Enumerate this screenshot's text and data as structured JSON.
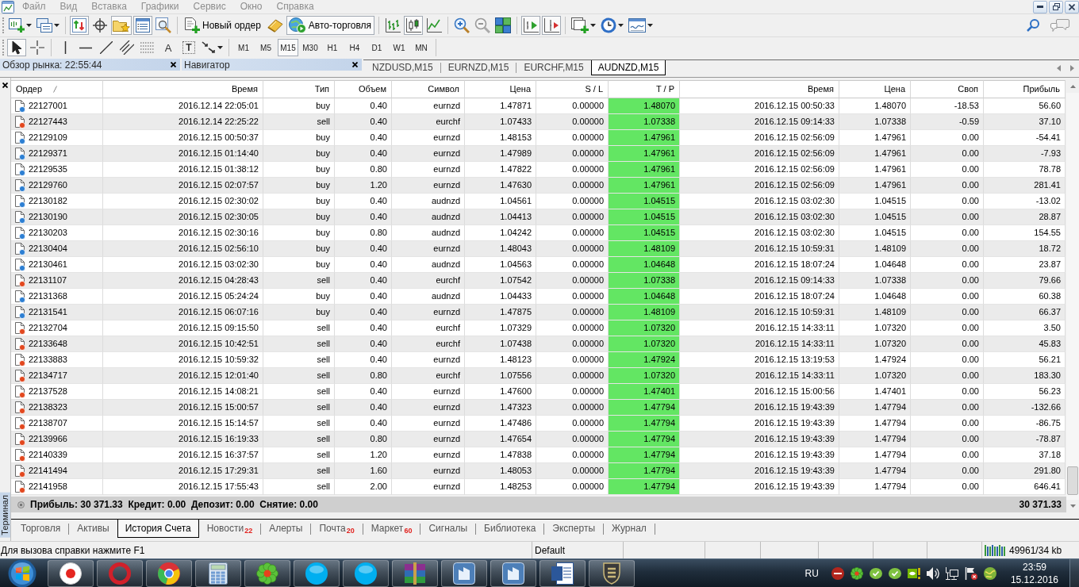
{
  "menu_bar": {
    "items": [
      "Файл",
      "Вид",
      "Вставка",
      "Графики",
      "Сервис",
      "Окно",
      "Справка"
    ]
  },
  "main_toolbar": {
    "buttons": [
      {
        "pressed": false
      },
      {
        "pressed": false
      },
      {
        "pressed": true
      },
      {
        "pressed": false
      },
      {
        "pressed": true
      },
      {
        "pressed": true
      },
      {
        "pressed": false
      },
      {
        "label": "Новый ордер",
        "pressed": false
      },
      {
        "pressed": false
      },
      {
        "label": "Авто-торговля",
        "pressed": true
      },
      {
        "pressed": false
      },
      {
        "pressed": true
      },
      {
        "pressed": false
      },
      {
        "pressed": false
      },
      {
        "pressed": false
      },
      {
        "pressed": false
      },
      {
        "pressed": true
      },
      {
        "pressed": true
      },
      {
        "pressed": false
      },
      {
        "pressed": false
      },
      {
        "pressed": false
      }
    ]
  },
  "drawing_toolbar": {
    "tools": [
      {
        "pressed": true
      },
      {
        "pressed": false
      },
      {
        "pressed": false
      },
      {
        "pressed": false
      },
      {
        "pressed": false
      },
      {
        "pressed": false
      },
      {
        "pressed": false
      },
      {
        "glyph": "A",
        "pressed": false
      },
      {
        "glyph": "T",
        "pressed": false
      },
      {
        "pressed": false
      }
    ],
    "timeframes": [
      {
        "label": "M1",
        "selected": false
      },
      {
        "label": "M5",
        "selected": false
      },
      {
        "label": "M15",
        "selected": true
      },
      {
        "label": "M30",
        "selected": false
      },
      {
        "label": "H1",
        "selected": false
      },
      {
        "label": "H4",
        "selected": false
      },
      {
        "label": "D1",
        "selected": false
      },
      {
        "label": "W1",
        "selected": false
      },
      {
        "label": "MN",
        "selected": false
      }
    ]
  },
  "market_watch": {
    "title": "Обзор рынка: 22:55:44"
  },
  "navigator": {
    "title": "Навигатор"
  },
  "chart_tabs": [
    {
      "label": "NZDUSD,M15",
      "selected": false
    },
    {
      "label": "EURNZD,M15",
      "selected": false
    },
    {
      "label": "EURCHF,M15",
      "selected": false
    },
    {
      "label": "AUDNZD,M15",
      "selected": true
    }
  ],
  "terminal": {
    "side_label": "Терминал",
    "columns": [
      {
        "label": "Ордер",
        "sorted": true
      },
      {
        "label": "Время",
        "sorted": false
      },
      {
        "label": "Тип",
        "sorted": false
      },
      {
        "label": "Объем",
        "sorted": false
      },
      {
        "label": "Символ",
        "sorted": false
      },
      {
        "label": "Цена",
        "sorted": false
      },
      {
        "label": "S / L",
        "sorted": false
      },
      {
        "label": "T / P",
        "sorted": false
      },
      {
        "label": "Время",
        "sorted": false
      },
      {
        "label": "Цена",
        "sorted": false
      },
      {
        "label": "Своп",
        "sorted": false
      },
      {
        "label": "Прибыль",
        "sorted": false
      }
    ],
    "rows": [
      {
        "kind": "buy",
        "order": "22127001",
        "open_time": "2016.12.14 22:05:01",
        "type": "buy",
        "volume": "0.40",
        "symbol": "eurnzd",
        "open_price": "1.47871",
        "sl": "0.00000",
        "tp": "1.48070",
        "tp_reached": true,
        "close_time": "2016.12.15 00:50:33",
        "close_price": "1.48070",
        "swap": "-18.53",
        "profit": "56.60"
      },
      {
        "kind": "sell",
        "order": "22127443",
        "open_time": "2016.12.14 22:25:22",
        "type": "sell",
        "volume": "0.40",
        "symbol": "eurchf",
        "open_price": "1.07433",
        "sl": "0.00000",
        "tp": "1.07338",
        "tp_reached": true,
        "close_time": "2016.12.15 09:14:33",
        "close_price": "1.07338",
        "swap": "-0.59",
        "profit": "37.10"
      },
      {
        "kind": "buy",
        "order": "22129109",
        "open_time": "2016.12.15 00:50:37",
        "type": "buy",
        "volume": "0.40",
        "symbol": "eurnzd",
        "open_price": "1.48153",
        "sl": "0.00000",
        "tp": "1.47961",
        "tp_reached": true,
        "close_time": "2016.12.15 02:56:09",
        "close_price": "1.47961",
        "swap": "0.00",
        "profit": "-54.41"
      },
      {
        "kind": "buy",
        "order": "22129371",
        "open_time": "2016.12.15 01:14:40",
        "type": "buy",
        "volume": "0.40",
        "symbol": "eurnzd",
        "open_price": "1.47989",
        "sl": "0.00000",
        "tp": "1.47961",
        "tp_reached": true,
        "close_time": "2016.12.15 02:56:09",
        "close_price": "1.47961",
        "swap": "0.00",
        "profit": "-7.93"
      },
      {
        "kind": "buy",
        "order": "22129535",
        "open_time": "2016.12.15 01:38:12",
        "type": "buy",
        "volume": "0.80",
        "symbol": "eurnzd",
        "open_price": "1.47822",
        "sl": "0.00000",
        "tp": "1.47961",
        "tp_reached": true,
        "close_time": "2016.12.15 02:56:09",
        "close_price": "1.47961",
        "swap": "0.00",
        "profit": "78.78"
      },
      {
        "kind": "buy",
        "order": "22129760",
        "open_time": "2016.12.15 02:07:57",
        "type": "buy",
        "volume": "1.20",
        "symbol": "eurnzd",
        "open_price": "1.47630",
        "sl": "0.00000",
        "tp": "1.47961",
        "tp_reached": true,
        "close_time": "2016.12.15 02:56:09",
        "close_price": "1.47961",
        "swap": "0.00",
        "profit": "281.41"
      },
      {
        "kind": "buy",
        "order": "22130182",
        "open_time": "2016.12.15 02:30:02",
        "type": "buy",
        "volume": "0.40",
        "symbol": "audnzd",
        "open_price": "1.04561",
        "sl": "0.00000",
        "tp": "1.04515",
        "tp_reached": true,
        "close_time": "2016.12.15 03:02:30",
        "close_price": "1.04515",
        "swap": "0.00",
        "profit": "-13.02"
      },
      {
        "kind": "buy",
        "order": "22130190",
        "open_time": "2016.12.15 02:30:05",
        "type": "buy",
        "volume": "0.40",
        "symbol": "audnzd",
        "open_price": "1.04413",
        "sl": "0.00000",
        "tp": "1.04515",
        "tp_reached": true,
        "close_time": "2016.12.15 03:02:30",
        "close_price": "1.04515",
        "swap": "0.00",
        "profit": "28.87"
      },
      {
        "kind": "buy",
        "order": "22130203",
        "open_time": "2016.12.15 02:30:16",
        "type": "buy",
        "volume": "0.80",
        "symbol": "audnzd",
        "open_price": "1.04242",
        "sl": "0.00000",
        "tp": "1.04515",
        "tp_reached": true,
        "close_time": "2016.12.15 03:02:30",
        "close_price": "1.04515",
        "swap": "0.00",
        "profit": "154.55"
      },
      {
        "kind": "buy",
        "order": "22130404",
        "open_time": "2016.12.15 02:56:10",
        "type": "buy",
        "volume": "0.40",
        "symbol": "eurnzd",
        "open_price": "1.48043",
        "sl": "0.00000",
        "tp": "1.48109",
        "tp_reached": true,
        "close_time": "2016.12.15 10:59:31",
        "close_price": "1.48109",
        "swap": "0.00",
        "profit": "18.72"
      },
      {
        "kind": "buy",
        "order": "22130461",
        "open_time": "2016.12.15 03:02:30",
        "type": "buy",
        "volume": "0.40",
        "symbol": "audnzd",
        "open_price": "1.04563",
        "sl": "0.00000",
        "tp": "1.04648",
        "tp_reached": true,
        "close_time": "2016.12.15 18:07:24",
        "close_price": "1.04648",
        "swap": "0.00",
        "profit": "23.87"
      },
      {
        "kind": "sell",
        "order": "22131107",
        "open_time": "2016.12.15 04:28:43",
        "type": "sell",
        "volume": "0.40",
        "symbol": "eurchf",
        "open_price": "1.07542",
        "sl": "0.00000",
        "tp": "1.07338",
        "tp_reached": true,
        "close_time": "2016.12.15 09:14:33",
        "close_price": "1.07338",
        "swap": "0.00",
        "profit": "79.66"
      },
      {
        "kind": "buy",
        "order": "22131368",
        "open_time": "2016.12.15 05:24:24",
        "type": "buy",
        "volume": "0.40",
        "symbol": "audnzd",
        "open_price": "1.04433",
        "sl": "0.00000",
        "tp": "1.04648",
        "tp_reached": true,
        "close_time": "2016.12.15 18:07:24",
        "close_price": "1.04648",
        "swap": "0.00",
        "profit": "60.38"
      },
      {
        "kind": "buy",
        "order": "22131541",
        "open_time": "2016.12.15 06:07:16",
        "type": "buy",
        "volume": "0.40",
        "symbol": "eurnzd",
        "open_price": "1.47875",
        "sl": "0.00000",
        "tp": "1.48109",
        "tp_reached": true,
        "close_time": "2016.12.15 10:59:31",
        "close_price": "1.48109",
        "swap": "0.00",
        "profit": "66.37"
      },
      {
        "kind": "sell",
        "order": "22132704",
        "open_time": "2016.12.15 09:15:50",
        "type": "sell",
        "volume": "0.40",
        "symbol": "eurchf",
        "open_price": "1.07329",
        "sl": "0.00000",
        "tp": "1.07320",
        "tp_reached": true,
        "close_time": "2016.12.15 14:33:11",
        "close_price": "1.07320",
        "swap": "0.00",
        "profit": "3.50"
      },
      {
        "kind": "sell",
        "order": "22133648",
        "open_time": "2016.12.15 10:42:51",
        "type": "sell",
        "volume": "0.40",
        "symbol": "eurchf",
        "open_price": "1.07438",
        "sl": "0.00000",
        "tp": "1.07320",
        "tp_reached": true,
        "close_time": "2016.12.15 14:33:11",
        "close_price": "1.07320",
        "swap": "0.00",
        "profit": "45.83"
      },
      {
        "kind": "sell",
        "order": "22133883",
        "open_time": "2016.12.15 10:59:32",
        "type": "sell",
        "volume": "0.40",
        "symbol": "eurnzd",
        "open_price": "1.48123",
        "sl": "0.00000",
        "tp": "1.47924",
        "tp_reached": true,
        "close_time": "2016.12.15 13:19:53",
        "close_price": "1.47924",
        "swap": "0.00",
        "profit": "56.21"
      },
      {
        "kind": "sell",
        "order": "22134717",
        "open_time": "2016.12.15 12:01:40",
        "type": "sell",
        "volume": "0.80",
        "symbol": "eurchf",
        "open_price": "1.07556",
        "sl": "0.00000",
        "tp": "1.07320",
        "tp_reached": true,
        "close_time": "2016.12.15 14:33:11",
        "close_price": "1.07320",
        "swap": "0.00",
        "profit": "183.30"
      },
      {
        "kind": "sell",
        "order": "22137528",
        "open_time": "2016.12.15 14:08:21",
        "type": "sell",
        "volume": "0.40",
        "symbol": "eurnzd",
        "open_price": "1.47600",
        "sl": "0.00000",
        "tp": "1.47401",
        "tp_reached": true,
        "close_time": "2016.12.15 15:00:56",
        "close_price": "1.47401",
        "swap": "0.00",
        "profit": "56.23"
      },
      {
        "kind": "sell",
        "order": "22138323",
        "open_time": "2016.12.15 15:00:57",
        "type": "sell",
        "volume": "0.40",
        "symbol": "eurnzd",
        "open_price": "1.47323",
        "sl": "0.00000",
        "tp": "1.47794",
        "tp_reached": true,
        "close_time": "2016.12.15 19:43:39",
        "close_price": "1.47794",
        "swap": "0.00",
        "profit": "-132.66"
      },
      {
        "kind": "sell",
        "order": "22138707",
        "open_time": "2016.12.15 15:14:57",
        "type": "sell",
        "volume": "0.40",
        "symbol": "eurnzd",
        "open_price": "1.47486",
        "sl": "0.00000",
        "tp": "1.47794",
        "tp_reached": true,
        "close_time": "2016.12.15 19:43:39",
        "close_price": "1.47794",
        "swap": "0.00",
        "profit": "-86.75"
      },
      {
        "kind": "sell",
        "order": "22139966",
        "open_time": "2016.12.15 16:19:33",
        "type": "sell",
        "volume": "0.80",
        "symbol": "eurnzd",
        "open_price": "1.47654",
        "sl": "0.00000",
        "tp": "1.47794",
        "tp_reached": true,
        "close_time": "2016.12.15 19:43:39",
        "close_price": "1.47794",
        "swap": "0.00",
        "profit": "-78.87"
      },
      {
        "kind": "sell",
        "order": "22140339",
        "open_time": "2016.12.15 16:37:57",
        "type": "sell",
        "volume": "1.20",
        "symbol": "eurnzd",
        "open_price": "1.47838",
        "sl": "0.00000",
        "tp": "1.47794",
        "tp_reached": true,
        "close_time": "2016.12.15 19:43:39",
        "close_price": "1.47794",
        "swap": "0.00",
        "profit": "37.18"
      },
      {
        "kind": "sell",
        "order": "22141494",
        "open_time": "2016.12.15 17:29:31",
        "type": "sell",
        "volume": "1.60",
        "symbol": "eurnzd",
        "open_price": "1.48053",
        "sl": "0.00000",
        "tp": "1.47794",
        "tp_reached": true,
        "close_time": "2016.12.15 19:43:39",
        "close_price": "1.47794",
        "swap": "0.00",
        "profit": "291.80"
      },
      {
        "kind": "sell",
        "order": "22141958",
        "open_time": "2016.12.15 17:55:43",
        "type": "sell",
        "volume": "2.00",
        "symbol": "eurnzd",
        "open_price": "1.48253",
        "sl": "0.00000",
        "tp": "1.47794",
        "tp_reached": true,
        "close_time": "2016.12.15 19:43:39",
        "close_price": "1.47794",
        "swap": "0.00",
        "profit": "646.41"
      }
    ],
    "summary": {
      "text": "Прибыль: 30 371.33  Кредит: 0.00  Депозит: 0.00  Снятие: 0.00",
      "total": "30 371.33"
    },
    "tabs": [
      {
        "label": "Торговля",
        "selected": false
      },
      {
        "label": "Активы",
        "selected": false
      },
      {
        "label": "История Счета",
        "selected": true
      },
      {
        "label": "Новости",
        "badge": "22",
        "selected": false
      },
      {
        "label": "Алерты",
        "selected": false
      },
      {
        "label": "Почта",
        "badge": "20",
        "selected": false
      },
      {
        "label": "Маркет",
        "badge": "60",
        "selected": false
      },
      {
        "label": "Сигналы",
        "selected": false
      },
      {
        "label": "Библиотека",
        "selected": false
      },
      {
        "label": "Эксперты",
        "selected": false
      },
      {
        "label": "Журнал",
        "selected": false
      }
    ]
  },
  "status_bar": {
    "help": "Для вызова справки нажмите F1",
    "profile": "Default",
    "traffic": "49961/34 kb"
  },
  "taskbar": {
    "language": "RU",
    "time": "23:59",
    "date": "15.12.2016"
  }
}
